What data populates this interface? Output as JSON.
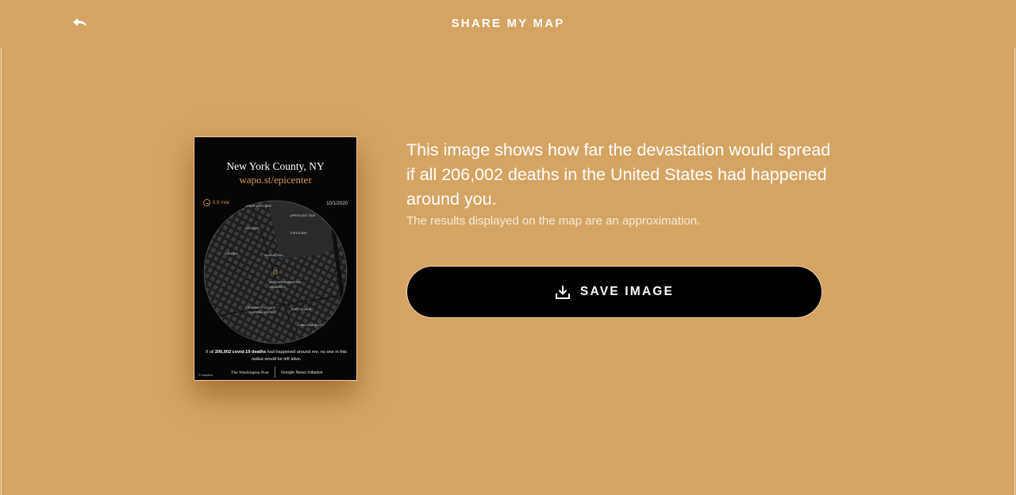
{
  "header": {
    "title": "SHARE MY MAP",
    "back_icon": "undo-arrow-icon"
  },
  "card": {
    "location": "New York County, NY",
    "url": "wapo.st/epicenter",
    "scale": "0.9 mile",
    "date": "10/1/2020",
    "caption_prefix": "If all ",
    "caption_bold": "206,002 covid-19 deaths",
    "caption_suffix": " had happened around me, no one in this radius would be left alive.",
    "footer_mapbox": "© mapbox",
    "footer_wapo": "The Washington Post",
    "footer_google": "Google News Initiative",
    "map_labels": [
      "UPPER WEST SIDE",
      "UPPER EAST SIDE",
      "MIDTOWN",
      "TURTLE BAY",
      "CHELSEA",
      "MURRAY HILL",
      "MIDTOWN MANHATTAN",
      "GRAMERCY",
      "GREENWICH VILLAGE",
      "EAST VILLAGE",
      "FLATIRON DISTRICT",
      "LONG ISLAND CITY"
    ]
  },
  "main": {
    "headline": "This image shows how far the devastation would spread if all 206,002 deaths in the United States had happened around you.",
    "note": "The results displayed on the map are an approximation.",
    "save_label": "SAVE IMAGE",
    "save_icon": "download-icon"
  },
  "colors": {
    "background": "#d6a462",
    "accent": "#d99a50",
    "button": "#000000",
    "text": "#ffffff"
  }
}
